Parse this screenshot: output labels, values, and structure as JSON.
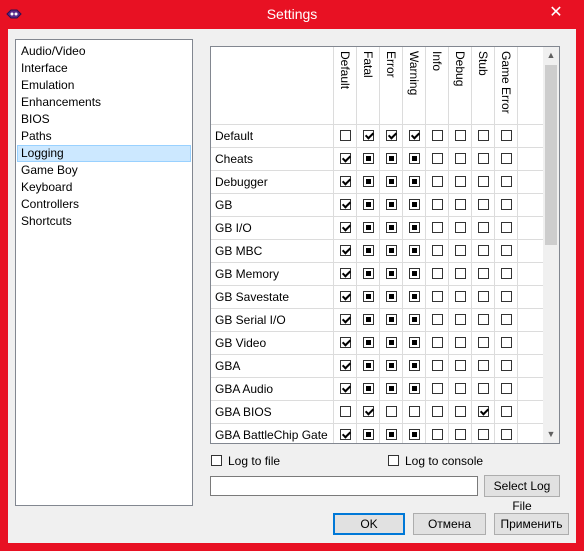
{
  "window": {
    "title": "Settings"
  },
  "categories": [
    "Audio/Video",
    "Interface",
    "Emulation",
    "Enhancements",
    "BIOS",
    "Paths",
    "Logging",
    "Game Boy",
    "Keyboard",
    "Controllers",
    "Shortcuts"
  ],
  "selected_category": "Logging",
  "columns": [
    "Default",
    "Fatal",
    "Error",
    "Warning",
    "Info",
    "Debug",
    "Stub",
    "Game Error"
  ],
  "rows": [
    {
      "name": "Default",
      "states": [
        "unchecked",
        "checked",
        "checked",
        "checked",
        "unchecked",
        "unchecked",
        "unchecked",
        "unchecked"
      ]
    },
    {
      "name": "Cheats",
      "states": [
        "checked",
        "partial",
        "partial",
        "partial",
        "unchecked",
        "unchecked",
        "unchecked",
        "unchecked"
      ]
    },
    {
      "name": "Debugger",
      "states": [
        "checked",
        "partial",
        "partial",
        "partial",
        "unchecked",
        "unchecked",
        "unchecked",
        "unchecked"
      ]
    },
    {
      "name": "GB",
      "states": [
        "checked",
        "partial",
        "partial",
        "partial",
        "unchecked",
        "unchecked",
        "unchecked",
        "unchecked"
      ]
    },
    {
      "name": "GB I/O",
      "states": [
        "checked",
        "partial",
        "partial",
        "partial",
        "unchecked",
        "unchecked",
        "unchecked",
        "unchecked"
      ]
    },
    {
      "name": "GB MBC",
      "states": [
        "checked",
        "partial",
        "partial",
        "partial",
        "unchecked",
        "unchecked",
        "unchecked",
        "unchecked"
      ]
    },
    {
      "name": "GB Memory",
      "states": [
        "checked",
        "partial",
        "partial",
        "partial",
        "unchecked",
        "unchecked",
        "unchecked",
        "unchecked"
      ]
    },
    {
      "name": "GB Savestate",
      "states": [
        "checked",
        "partial",
        "partial",
        "partial",
        "unchecked",
        "unchecked",
        "unchecked",
        "unchecked"
      ]
    },
    {
      "name": "GB Serial I/O",
      "states": [
        "checked",
        "partial",
        "partial",
        "partial",
        "unchecked",
        "unchecked",
        "unchecked",
        "unchecked"
      ]
    },
    {
      "name": "GB Video",
      "states": [
        "checked",
        "partial",
        "partial",
        "partial",
        "unchecked",
        "unchecked",
        "unchecked",
        "unchecked"
      ]
    },
    {
      "name": "GBA",
      "states": [
        "checked",
        "partial",
        "partial",
        "partial",
        "unchecked",
        "unchecked",
        "unchecked",
        "unchecked"
      ]
    },
    {
      "name": "GBA Audio",
      "states": [
        "checked",
        "partial",
        "partial",
        "partial",
        "unchecked",
        "unchecked",
        "unchecked",
        "unchecked"
      ]
    },
    {
      "name": "GBA BIOS",
      "states": [
        "unchecked",
        "checked",
        "unchecked",
        "unchecked",
        "unchecked",
        "unchecked",
        "checked",
        "unchecked"
      ]
    },
    {
      "name": "GBA BattleChip Gate",
      "states": [
        "checked",
        "partial",
        "partial",
        "partial",
        "unchecked",
        "unchecked",
        "unchecked",
        "unchecked"
      ]
    }
  ],
  "options": {
    "log_to_file": "Log to file",
    "log_to_console": "Log to console"
  },
  "log_file_path": "",
  "buttons": {
    "select_log_file": "Select Log File",
    "ok": "OK",
    "cancel": "Отмена",
    "apply": "Применить"
  },
  "colors": {
    "titlebar": "#e81123",
    "selection": "#cce8ff"
  }
}
